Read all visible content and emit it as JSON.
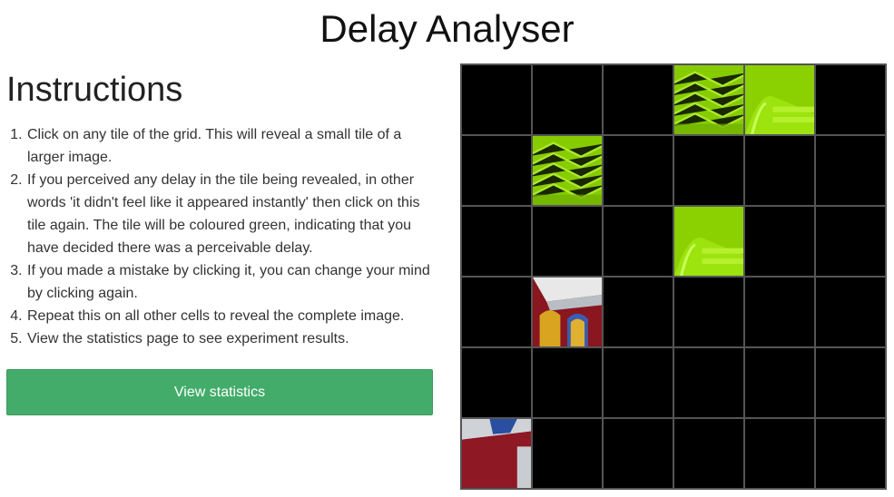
{
  "page": {
    "title": "Delay Analyser"
  },
  "instructions": {
    "heading": "Instructions",
    "steps": [
      "Click on any tile of the grid. This will reveal a small tile of a larger image.",
      "If you perceived any delay in the tile being revealed, in other words 'it didn't feel like it appeared instantly' then click on this tile again. The tile will be coloured green, indicating that you have decided there was a perceivable delay.",
      "If you made a mistake by clicking it, you can change your mind by clicking again.",
      "Repeat this on all other cells to reveal the complete image.",
      "View the statistics page to see experiment results."
    ]
  },
  "actions": {
    "view_statistics_label": "View statistics"
  },
  "grid": {
    "rows": 6,
    "cols": 6,
    "cells": [
      [
        "hidden",
        "hidden",
        "hidden",
        "delay-marked",
        "delay-marked",
        "hidden"
      ],
      [
        "hidden",
        "delay-marked",
        "hidden",
        "hidden",
        "hidden",
        "hidden"
      ],
      [
        "hidden",
        "hidden",
        "hidden",
        "delay-marked",
        "hidden",
        "hidden"
      ],
      [
        "hidden",
        "revealed",
        "hidden",
        "hidden",
        "hidden",
        "hidden"
      ],
      [
        "hidden",
        "hidden",
        "hidden",
        "hidden",
        "hidden",
        "hidden"
      ],
      [
        "revealed",
        "hidden",
        "hidden",
        "hidden",
        "hidden",
        "hidden"
      ]
    ]
  },
  "colors": {
    "button": "#43ac6a",
    "delay_tint": "#8fd400",
    "hidden_tile": "#000000",
    "grid_line": "#555555"
  }
}
